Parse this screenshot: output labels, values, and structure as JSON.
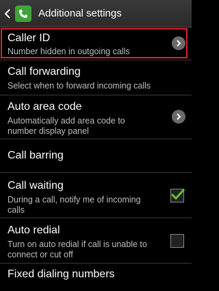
{
  "header": {
    "title": "Additional settings"
  },
  "items": [
    {
      "title": "Caller ID",
      "subtitle": "Number hidden in outgoing calls"
    },
    {
      "title": "Call forwarding",
      "subtitle": "Select when to forward incoming calls"
    },
    {
      "title": "Auto area code",
      "subtitle1": "Automatically add area code to",
      "subtitle2": "number display panel"
    },
    {
      "title": "Call barring"
    },
    {
      "title": "Call waiting",
      "subtitle1": "During a call, notify me of incoming",
      "subtitle2": "calls",
      "checked": true
    },
    {
      "title": "Auto redial",
      "subtitle1": "Turn on auto redial if call is unable to",
      "subtitle2": "connect or cut off",
      "checked": false
    },
    {
      "title": "Fixed dialing numbers"
    }
  ],
  "colors": {
    "highlight": "#d7262b",
    "check": "#5fc42f",
    "phone_icon_bg": "#3fa23a"
  },
  "icons": [
    "back-chevron-icon",
    "phone-icon",
    "chevron-right-icon",
    "checkbox-checked",
    "checkbox-unchecked"
  ]
}
